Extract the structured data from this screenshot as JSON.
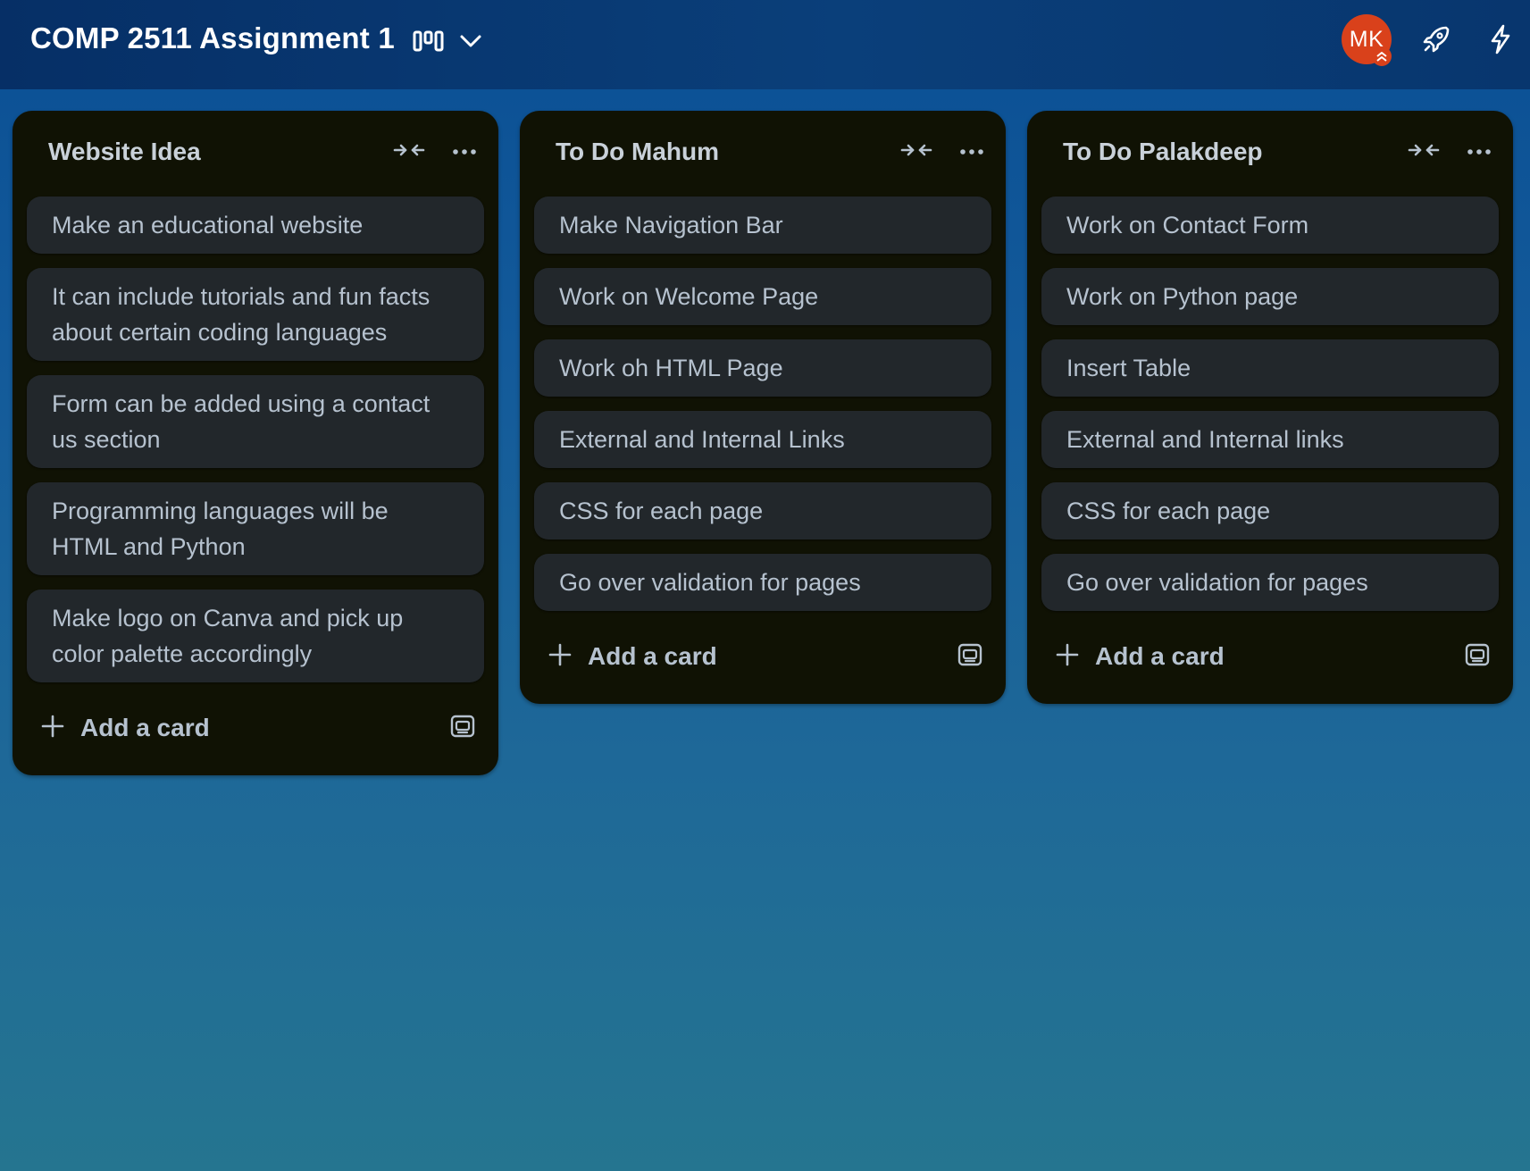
{
  "board": {
    "title": "COMP 2511 Assignment 1",
    "view_switcher_icon": "board-view-icon",
    "view_dropdown_icon": "chevron-down-icon"
  },
  "header": {
    "avatar_initials": "MK",
    "avatar_color": "#d9411b",
    "icons": [
      "power-ups-rocket-icon",
      "automation-lightning-icon"
    ]
  },
  "lists": [
    {
      "title": "Website Idea",
      "cards": [
        "Make an educational website",
        "It can include tutorials and fun facts about certain coding languages",
        "Form can be added using a contact us section",
        "Programming languages will be HTML and Python",
        "Make logo on Canva and pick up color palette accordingly"
      ],
      "add_card_label": "Add a card"
    },
    {
      "title": "To Do Mahum",
      "cards": [
        "Make Navigation Bar",
        "Work on Welcome Page",
        "Work oh HTML Page",
        "External and Internal Links",
        "CSS for each page",
        "Go over validation for pages"
      ],
      "add_card_label": "Add a card"
    },
    {
      "title": "To Do Palakdeep",
      "cards": [
        "Work on Contact Form",
        "Work on Python page",
        "Insert Table",
        "External and Internal links",
        "CSS for each page",
        "Go over validation for pages"
      ],
      "add_card_label": "Add a card"
    }
  ],
  "colors": {
    "list_background": "#101204",
    "card_background": "#22272b",
    "card_text": "#b6c2cf",
    "topbar": "#0a3f7a"
  }
}
